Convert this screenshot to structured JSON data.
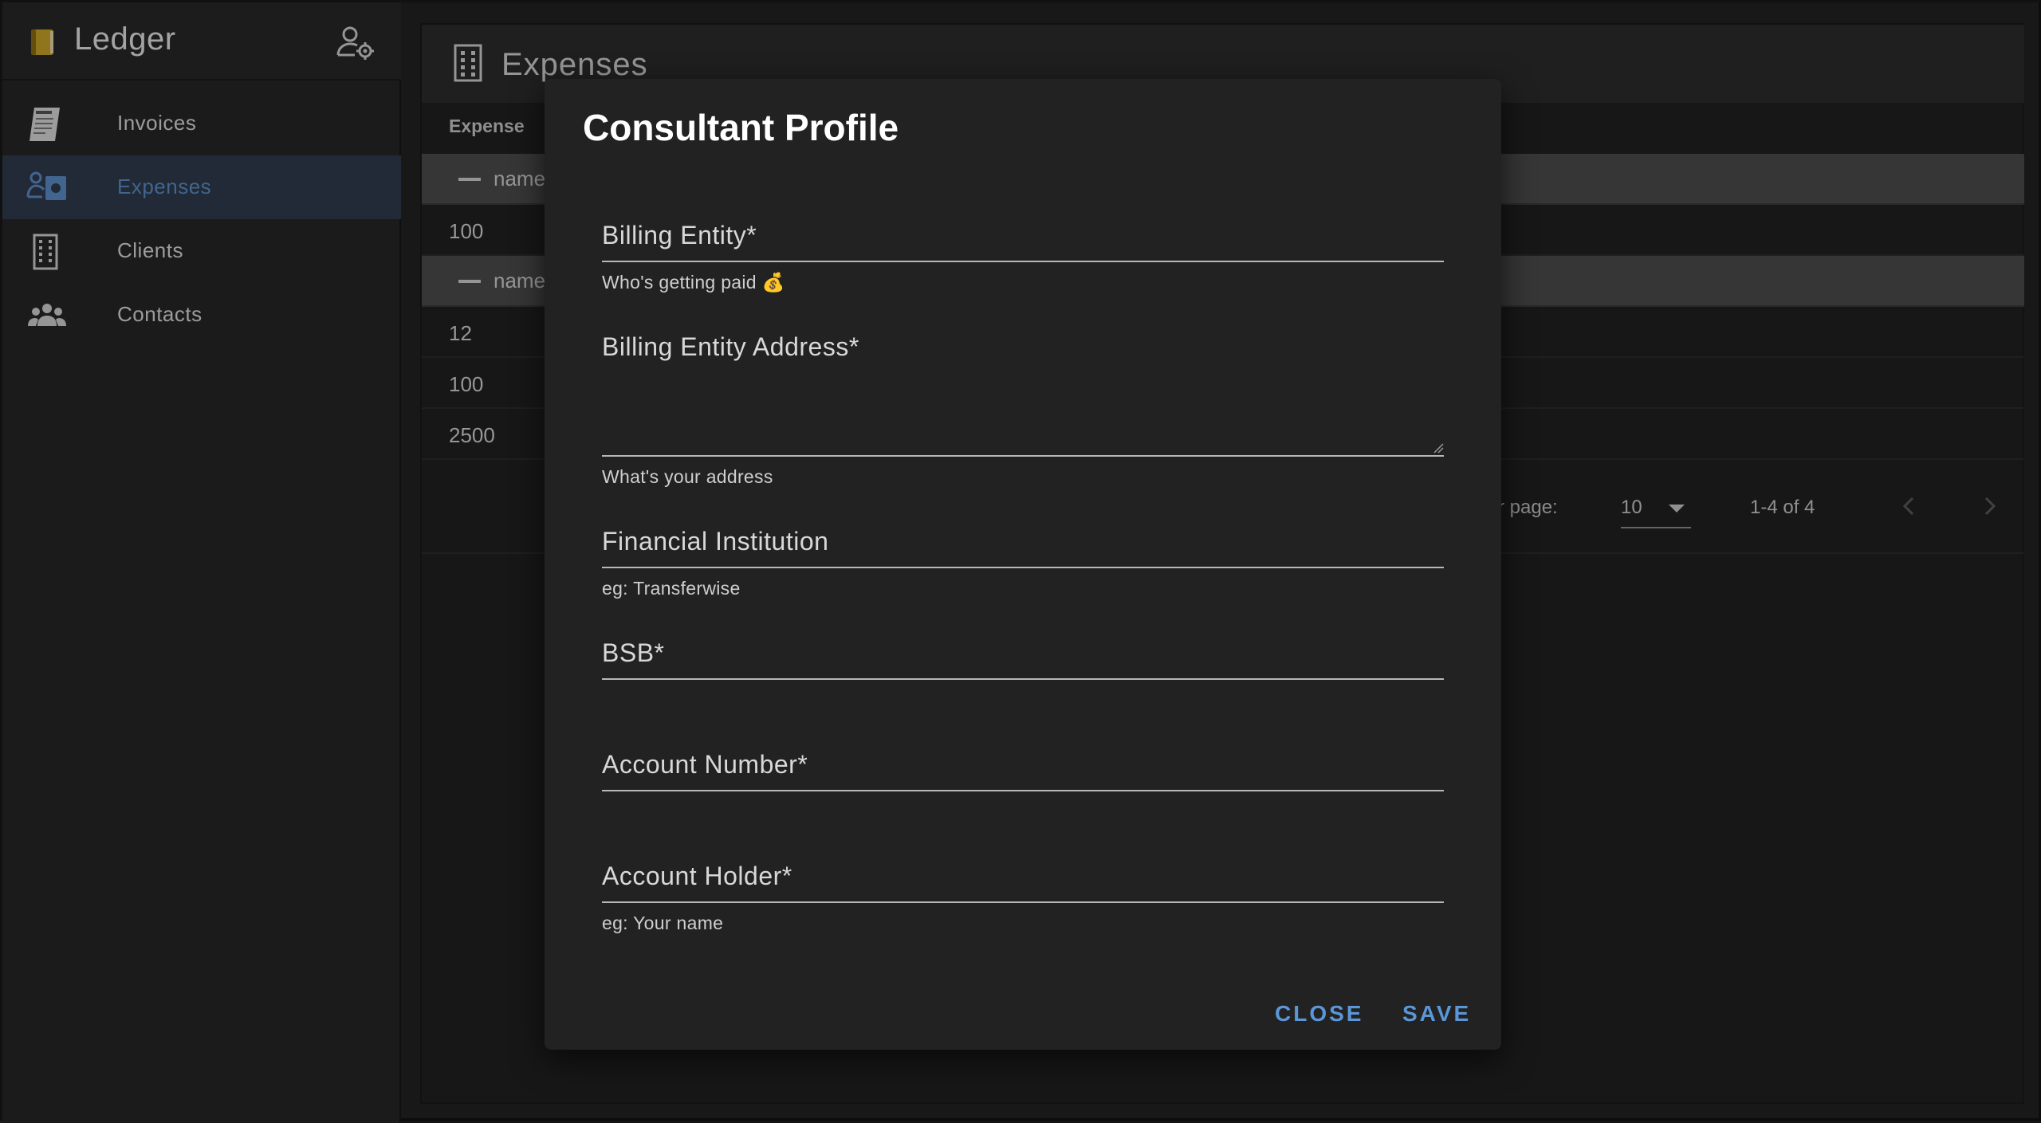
{
  "app": {
    "title": "Ledger"
  },
  "sidebar": {
    "items": [
      {
        "label": "Invoices",
        "icon": "receipt-icon",
        "active": false
      },
      {
        "label": "Expenses",
        "icon": "expenses-icon",
        "active": true
      },
      {
        "label": "Clients",
        "icon": "building-icon",
        "active": false
      },
      {
        "label": "Contacts",
        "icon": "people-icon",
        "active": false
      }
    ]
  },
  "main": {
    "title": "Expenses",
    "table": {
      "header": "Expense",
      "rows": [
        {
          "type": "group",
          "label": "name"
        },
        {
          "type": "value",
          "value": "100"
        },
        {
          "type": "group",
          "label": "name"
        },
        {
          "type": "value",
          "value": "12"
        },
        {
          "type": "value",
          "value": "100"
        },
        {
          "type": "value",
          "value": "2500"
        }
      ]
    },
    "pagination": {
      "rows_per_page_label": "r page:",
      "rows_per_page_value": "10",
      "range": "1-4 of 4"
    }
  },
  "modal": {
    "title": "Consultant Profile",
    "fields": [
      {
        "label": "Billing Entity*",
        "helper": "Who's getting paid 💰",
        "value": ""
      },
      {
        "label": "Billing Entity Address*",
        "helper": "What's your address",
        "value": ""
      },
      {
        "label": "Financial Institution",
        "helper": "eg: Transferwise",
        "value": ""
      },
      {
        "label": "BSB*",
        "helper": "",
        "value": ""
      },
      {
        "label": "Account Number*",
        "helper": "",
        "value": ""
      },
      {
        "label": "Account Holder*",
        "helper": "eg: Your name",
        "value": ""
      }
    ],
    "actions": {
      "close": "CLOSE",
      "save": "SAVE"
    }
  },
  "colors": {
    "accent": "#5b97d8",
    "active_nav_bg": "#2e3b4b",
    "active_nav_text": "#5b8cc6",
    "modal_bg": "#222222",
    "group_row_bg": "#4b4b4b"
  }
}
